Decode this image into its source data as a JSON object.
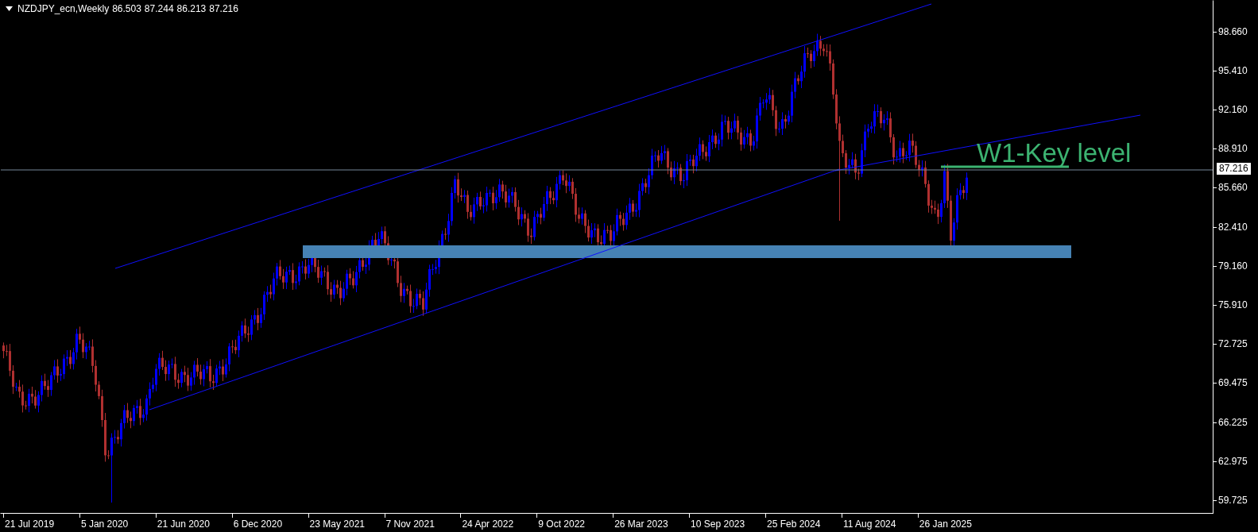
{
  "header": {
    "symbol": "NZDJPY_ecn,Weekly",
    "ohlc": [
      "86.503",
      "87.244",
      "86.213",
      "87.216"
    ]
  },
  "price_axis": {
    "labels": [
      "98.660",
      "95.410",
      "92.160",
      "88.910",
      "85.660",
      "82.410",
      "79.160",
      "75.910",
      "72.725",
      "69.475",
      "66.225",
      "62.975",
      "59.725"
    ],
    "current_price": "87.216"
  },
  "time_axis": {
    "labels": [
      "21 Jul 2019",
      "5 Jan 2020",
      "21 Jun 2020",
      "6 Dec 2020",
      "23 May 2021",
      "7 Nov 2021",
      "24 Apr 2022",
      "9 Oct 2022",
      "26 Mar 2023",
      "10 Sep 2023",
      "25 Feb 2024",
      "11 Aug 2024",
      "26 Jan 2025"
    ]
  },
  "annotation": {
    "text": "W1-Key level"
  }
}
